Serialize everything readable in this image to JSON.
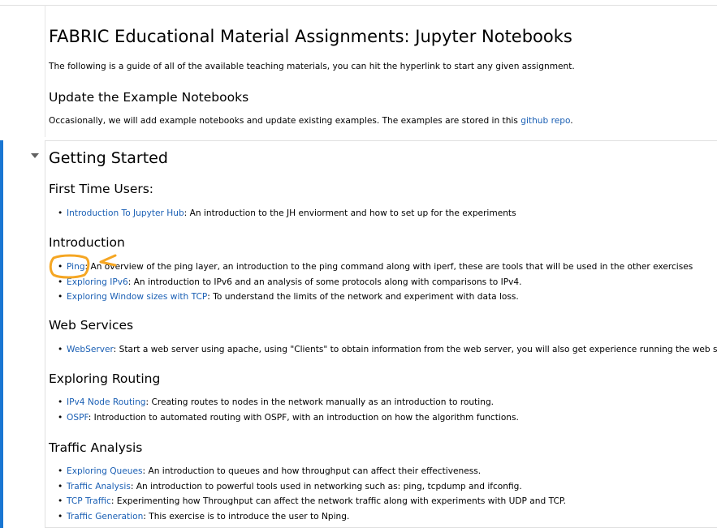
{
  "header": {
    "title": "FABRIC Educational Material Assignments: Jupyter Notebooks",
    "intro": "The following is a guide of all of the available teaching materials, you can hit the hyperlink to start any given assignment."
  },
  "update": {
    "heading": "Update the Example Notebooks",
    "text": "Occasionally, we will add example notebooks and update existing examples. The examples are stored in this ",
    "link": "github repo",
    "suffix": "."
  },
  "getting_started": {
    "heading": "Getting Started",
    "sections": [
      {
        "heading": "First Time Users:",
        "items": [
          {
            "link": "Introduction To Jupyter Hub",
            "text": ": An introduction to the JH enviorment and how to set up for the experiments"
          }
        ]
      },
      {
        "heading": "Introduction",
        "items": [
          {
            "link": "Ping",
            "text": ": An overview of the ping layer, an introduction to the ping command along with iperf, these are tools that will be used in the other exercises"
          },
          {
            "link": "Exploring IPv6",
            "text": ": An introduction to IPv6 and an analysis of some protocols along with comparisons to IPv4."
          },
          {
            "link": "Exploring Window sizes with TCP",
            "text": ": To understand the limits of the network and experiment with data loss."
          }
        ]
      },
      {
        "heading": "Web Services",
        "items": [
          {
            "link": "WebServer",
            "text": ": Start a web server using apache, using \"Clients\" to obtain information from the web server, you will also get experience running the web server"
          }
        ]
      },
      {
        "heading": "Exploring Routing",
        "items": [
          {
            "link": "IPv4 Node Routing",
            "text": ": Creating routes to nodes in the network manually as an introduction to routing."
          },
          {
            "link": "OSPF",
            "text": ": Introduction to automated routing with OSPF, with an introduction on how the algorithm functions."
          }
        ]
      },
      {
        "heading": "Traffic Analysis",
        "items": [
          {
            "link": "Exploring Queues",
            "text": ": An introduction to queues and how throughput can affect their effectiveness."
          },
          {
            "link": "Traffic Analysis",
            "text": ": An introduction to powerful tools used in networking such as: ping, tcpdump and ifconfig."
          },
          {
            "link": "TCP Traffic",
            "text": ": Experimenting how Throughput can affect the network traffic along with experiments with UDP and TCP."
          },
          {
            "link": "Traffic Generation",
            "text": ": This exercise is to introduce the user to Nping."
          }
        ]
      }
    ]
  },
  "colors": {
    "link": "#1a5fb4",
    "active_cell": "#1976d2",
    "annotation": "#f5a623"
  }
}
